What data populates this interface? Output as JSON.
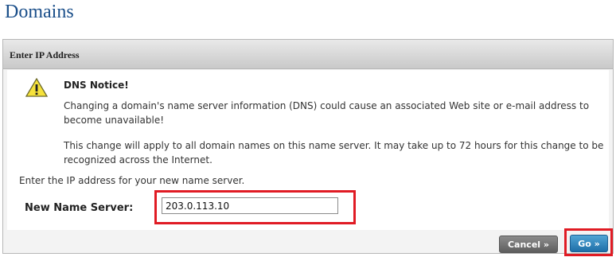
{
  "page": {
    "title": "Domains"
  },
  "panel": {
    "header": "Enter IP Address"
  },
  "notice": {
    "icon": "warning-icon",
    "title": "DNS Notice!",
    "line1": "Changing a domain's name server information (DNS) could cause an associated Web site or e-mail address to become unavailable!",
    "line2": "This change will apply to all domain names on this name server. It may take up to 72 hours for this change to be recognized across the Internet."
  },
  "form": {
    "instruction": "Enter the IP address for your new name server.",
    "label": "New Name Server:",
    "value": "203.0.113.10"
  },
  "buttons": {
    "cancel": "Cancel »",
    "go": "Go »"
  },
  "colors": {
    "title": "#1b4f8a",
    "highlight": "#e01b24",
    "go": "#1f6fa8",
    "cancel": "#6f6f6f"
  }
}
